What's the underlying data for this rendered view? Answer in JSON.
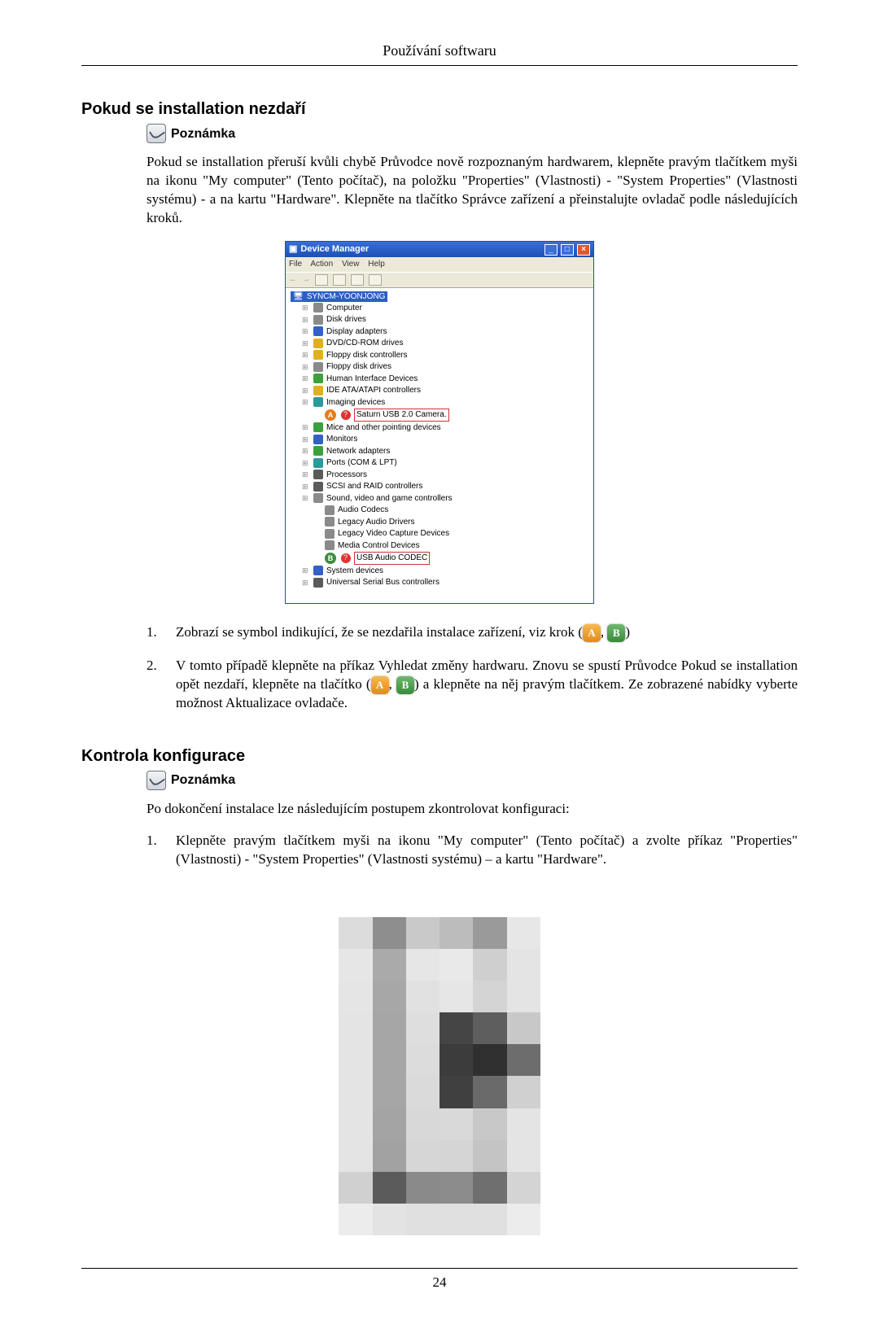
{
  "header": "Používání softwaru",
  "section1": {
    "title": "Pokud se installation nezdaří",
    "note_label": "Poznámka",
    "paragraph": "Pokud se installation přeruší kvůli chybě Průvodce nově rozpoznaným hardwarem, klepněte pravým tlačítkem myši na ikonu \"My computer\" (Tento počítač), na položku \"Properties\" (Vlastnosti) - \"System Properties\" (Vlastnosti systému) - a na kartu \"Hardware\". Klepněte na tlačítko Správce zařízení a přeinstalujte ovladač podle následujících kroků."
  },
  "device_manager": {
    "title": "Device Manager",
    "menu": [
      "File",
      "Action",
      "View",
      "Help"
    ],
    "root": "SYNCM-YOONJONG",
    "items": [
      {
        "label": "Computer",
        "ico": "gray"
      },
      {
        "label": "Disk drives",
        "ico": "gray"
      },
      {
        "label": "Display adapters",
        "ico": "blue"
      },
      {
        "label": "DVD/CD-ROM drives",
        "ico": "yellow"
      },
      {
        "label": "Floppy disk controllers",
        "ico": "yellow"
      },
      {
        "label": "Floppy disk drives",
        "ico": "gray"
      },
      {
        "label": "Human Interface Devices",
        "ico": "green"
      },
      {
        "label": "IDE ATA/ATAPI controllers",
        "ico": "yellow"
      },
      {
        "label": "Imaging devices",
        "ico": "teal",
        "expanded": true
      },
      {
        "label": "Saturn USB 2.0 Camera.",
        "ico": "red",
        "leaf": true,
        "boxed": true,
        "callout": "A"
      },
      {
        "label": "Mice and other pointing devices",
        "ico": "green"
      },
      {
        "label": "Monitors",
        "ico": "blue"
      },
      {
        "label": "Network adapters",
        "ico": "green"
      },
      {
        "label": "Ports (COM & LPT)",
        "ico": "teal"
      },
      {
        "label": "Processors",
        "ico": "darkgray"
      },
      {
        "label": "SCSI and RAID controllers",
        "ico": "darkgray"
      },
      {
        "label": "Sound, video and game controllers",
        "ico": "gray",
        "expanded": true
      },
      {
        "label": "Audio Codecs",
        "ico": "gray",
        "leaf": true
      },
      {
        "label": "Legacy Audio Drivers",
        "ico": "gray",
        "leaf": true
      },
      {
        "label": "Legacy Video Capture Devices",
        "ico": "gray",
        "leaf": true
      },
      {
        "label": "Media Control Devices",
        "ico": "gray",
        "leaf": true
      },
      {
        "label": "USB Audio CODEC",
        "ico": "red",
        "leaf": true,
        "boxed": true,
        "callout": "B",
        "callout_green": true
      },
      {
        "label": "System devices",
        "ico": "blue"
      },
      {
        "label": "Universal Serial Bus controllers",
        "ico": "darkgray"
      }
    ]
  },
  "list1": [
    {
      "num": "1.",
      "pre": "Zobrazí se symbol indikující, že se nezdařila instalace zařízení, viz krok (",
      "iconA": "A",
      "mid": ", ",
      "iconB": "B",
      "post": ")"
    },
    {
      "num": "2.",
      "pre": "V tomto případě klepněte na příkaz Vyhledat změny hardwaru. Znovu se spustí Průvodce Pokud se installation opět nezdaří, klepněte na tlačítko (",
      "iconA": "A",
      "mid": ", ",
      "iconB": "B",
      "post": ") a klepněte na něj pravým tlačítkem. Ze zobrazené nabídky vyberte možnost Aktualizace ovladače."
    }
  ],
  "section2": {
    "title": "Kontrola konfigurace",
    "note_label": "Poznámka",
    "paragraph": "Po dokončení instalace lze následujícím postupem zkontrolovat konfiguraci:",
    "step": {
      "num": "1.",
      "text": "Klepněte pravým tlačítkem myši na ikonu \"My computer\" (Tento počítač) a zvolte příkaz \"Properties\" (Vlastnosti) - \"System Properties\" (Vlastnosti systému) – a kartu \"Hardware\"."
    }
  },
  "page_number": "24",
  "pixel_grid": [
    [
      "#fff",
      "#fff",
      "#fff",
      "#fff",
      "#fff",
      "#fff",
      "#fff",
      "#fff"
    ],
    [
      "#fff",
      "#dcdcdc",
      "#8e8e8e",
      "#c9c9c9",
      "#bcbcbc",
      "#9a9a9a",
      "#e7e7e7",
      "#fff"
    ],
    [
      "#fff",
      "#e6e6e6",
      "#aaaaaa",
      "#e6e6e6",
      "#e9e9e9",
      "#cfcfcf",
      "#e4e4e4",
      "#fff"
    ],
    [
      "#fff",
      "#e5e5e5",
      "#a7a7a7",
      "#e1e1e1",
      "#e6e6e6",
      "#d4d4d4",
      "#e4e4e4",
      "#fff"
    ],
    [
      "#fff",
      "#e4e4e4",
      "#a6a6a6",
      "#dedede",
      "#454545",
      "#5e5e5e",
      "#c8c8c8",
      "#fff"
    ],
    [
      "#fff",
      "#e4e4e4",
      "#a6a6a6",
      "#dcdcdc",
      "#3c3c3c",
      "#303030",
      "#6d6d6d",
      "#fff"
    ],
    [
      "#fff",
      "#e4e4e4",
      "#a6a6a6",
      "#dadada",
      "#404040",
      "#6a6a6a",
      "#d0d0d0",
      "#fff"
    ],
    [
      "#fff",
      "#e4e4e4",
      "#a4a4a4",
      "#d8d8d8",
      "#d9d9d9",
      "#c8c8c8",
      "#e4e4e4",
      "#fff"
    ],
    [
      "#fff",
      "#e4e4e4",
      "#a2a2a2",
      "#d6d6d6",
      "#d5d5d5",
      "#c4c4c4",
      "#e4e4e4",
      "#fff"
    ],
    [
      "#fff",
      "#d0d0d0",
      "#5b5b5b",
      "#8a8a8a",
      "#8c8c8c",
      "#6f6f6f",
      "#d4d4d4",
      "#fff"
    ],
    [
      "#fff",
      "#ececec",
      "#e3e3e3",
      "#e0e0e0",
      "#e0e0e0",
      "#e0e0e0",
      "#ececec",
      "#fff"
    ]
  ]
}
